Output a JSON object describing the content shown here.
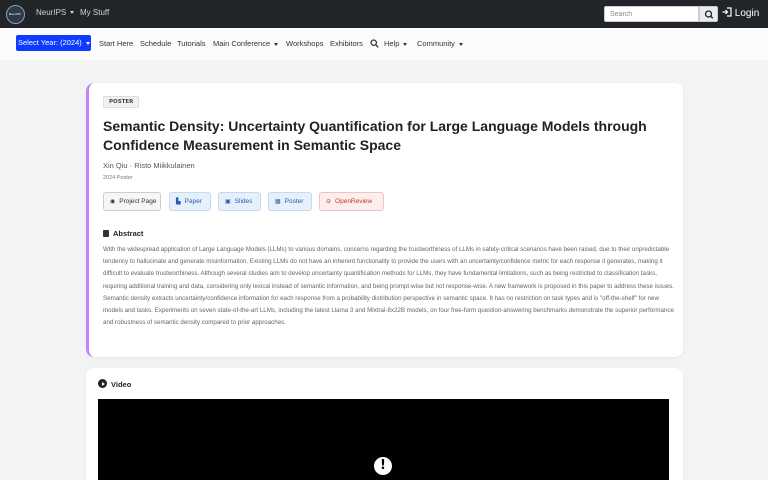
{
  "topbar": {
    "logo_text": "NeurIPS",
    "nav": [
      {
        "label": "NeurIPS",
        "has_dropdown": true
      },
      {
        "label": "My Stuff",
        "has_dropdown": false
      }
    ],
    "search_placeholder": "Search",
    "login_label": "Login"
  },
  "subnav": {
    "year_select": "Select Year: (2024)",
    "items": [
      {
        "label": "Start Here",
        "has_dropdown": false
      },
      {
        "label": "Schedule",
        "has_dropdown": false
      },
      {
        "label": "Tutorials",
        "has_dropdown": false
      },
      {
        "label": "Main Conference",
        "has_dropdown": true
      },
      {
        "label": "Workshops",
        "has_dropdown": false
      },
      {
        "label": "Exhibitors",
        "has_dropdown": false
      },
      {
        "label": "Help",
        "has_dropdown": true
      },
      {
        "label": "Community",
        "has_dropdown": true
      }
    ]
  },
  "paper": {
    "badge": "POSTER",
    "title": "Semantic Density: Uncertainty Quantification for Large Language Models through Confidence Measurement in Semantic Space",
    "authors": "Xin Qiu · Risto Miikkulainen",
    "event": "2024 Poster",
    "buttons": {
      "project_page": "Project Page",
      "paper": "Paper",
      "slides": "Slides",
      "poster": "Poster",
      "openreview": "OpenReview"
    },
    "abstract_heading": "Abstract",
    "abstract": "With the widespread application of Large Language Models (LLMs) to various domains, concerns regarding the trustworthiness of LLMs in safety-critical scenarios have been raised, due to their unpredictable tendency to hallucinate and generate misinformation. Existing LLMs do not have an inherent functionality to provide the users with an uncertainty/confidence metric for each response it generates, making it difficult to evaluate trustworthiness. Although several studies aim to develop uncertainty quantification methods for LLMs, they have fundamental limitations, such as being restricted to classification tasks, requiring additional training and data, considering only lexical instead of semantic information, and being prompt-wise but not response-wise. A new framework is proposed in this paper to address these issues. Semantic density extracts uncertainty/confidence information for each response from a probability distribution perspective in semantic space. It has no restriction on task types and is \"off-the-shelf\" for new models and tasks. Experiments on seven state-of-the-art LLMs, including the latest Llama 3 and Mixtral-8x22B models, on four free-form question-answering benchmarks demonstrate the superior performance and robustness of semantic density compared to prior approaches."
  },
  "video": {
    "heading": "Video"
  },
  "colors": {
    "topbar": "#212529",
    "year_button": "#0d3bff",
    "card_accent": "#c084fc"
  }
}
